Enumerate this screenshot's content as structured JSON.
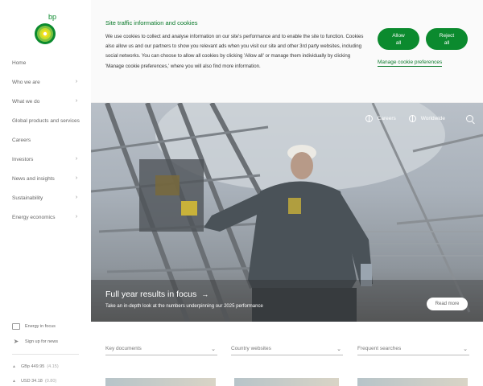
{
  "brand": {
    "logo_text": "bp",
    "green": "#0b8a2e",
    "yellow": "#f3e01a"
  },
  "sidebar": {
    "items": [
      {
        "label": "Home",
        "has_chevron": false
      },
      {
        "label": "Who we are",
        "has_chevron": true
      },
      {
        "label": "What we do",
        "has_chevron": true
      },
      {
        "label": "Global products and services",
        "has_chevron": false
      },
      {
        "label": "Careers",
        "has_chevron": false
      },
      {
        "label": "Investors",
        "has_chevron": true
      },
      {
        "label": "News and insights",
        "has_chevron": true
      },
      {
        "label": "Sustainability",
        "has_chevron": true
      },
      {
        "label": "Energy economics",
        "has_chevron": true
      }
    ],
    "chevron": "›",
    "energy_in_focus": "Energy in focus",
    "sign_up": "Sign up for news",
    "tickers": [
      {
        "label": "GBp 449.95",
        "change": "(4.15)"
      },
      {
        "label": "USD 34.18",
        "change": "(0.80)"
      }
    ]
  },
  "cookie": {
    "title": "Site traffic information and cookies",
    "body": "We use cookies to collect and analyse information on our site's performance and to enable the site to function. Cookies also allow us and our partners to show you relevant ads when you visit our site and other 3rd party websites, including social networks. You can choose to allow all cookies by clicking 'Allow all' or manage them individually by clicking 'Manage cookie preferences,' where you will also find more information.",
    "allow_line1": "Allow",
    "allow_line2": "all",
    "reject_line1": "Reject",
    "reject_line2": "all",
    "manage": "Manage cookie preferences"
  },
  "hero": {
    "careers": "Careers",
    "worldwide": "Worldwide",
    "title": "Full year results in focus",
    "arrow": "→",
    "subtitle": "Take an in-depth look at the numbers underpinning our 2025 performance",
    "button": "Read more"
  },
  "dropdowns": [
    {
      "label": "Key documents"
    },
    {
      "label": "Country websites"
    },
    {
      "label": "Frequent searches"
    }
  ],
  "dropdown_chevron": "⌄"
}
